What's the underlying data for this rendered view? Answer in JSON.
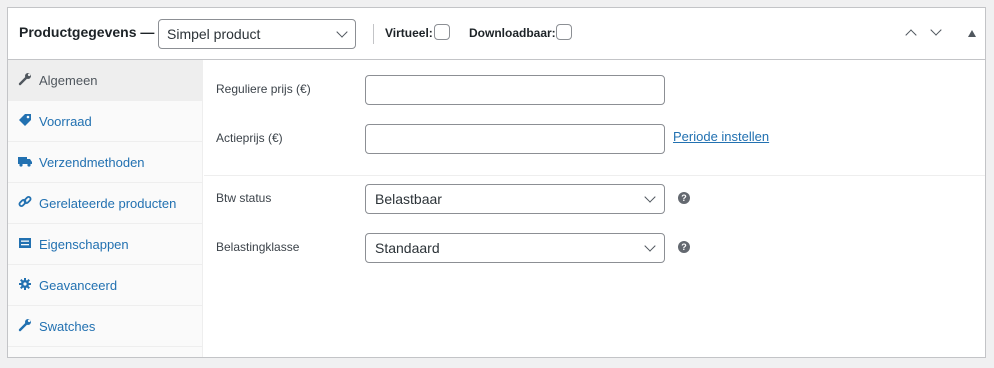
{
  "header": {
    "title": "Productgegevens —",
    "product_type": "Simpel product",
    "virtual_label": "Virtueel:",
    "downloadable_label": "Downloadbaar:"
  },
  "tabs": [
    {
      "label": "Algemeen",
      "icon": "wrench-icon",
      "active": true
    },
    {
      "label": "Voorraad",
      "icon": "tag-icon",
      "active": false
    },
    {
      "label": "Verzendmethoden",
      "icon": "truck-icon",
      "active": false
    },
    {
      "label": "Gerelateerde producten",
      "icon": "link-icon",
      "active": false
    },
    {
      "label": "Eigenschappen",
      "icon": "list-icon",
      "active": false
    },
    {
      "label": "Geavanceerd",
      "icon": "gear-icon",
      "active": false
    },
    {
      "label": "Swatches",
      "icon": "wrench-icon",
      "active": false
    }
  ],
  "fields": {
    "regular_price_label": "Reguliere prijs (€)",
    "regular_price_value": "",
    "sale_price_label": "Actieprijs (€)",
    "sale_price_value": "",
    "schedule_link": "Periode instellen",
    "tax_status_label": "Btw status",
    "tax_status_value": "Belastbaar",
    "tax_class_label": "Belastingklasse",
    "tax_class_value": "Standaard"
  },
  "colors": {
    "link": "#2271b1",
    "active_tab_bg": "#eeeeee",
    "border": "#c3c4c7"
  }
}
